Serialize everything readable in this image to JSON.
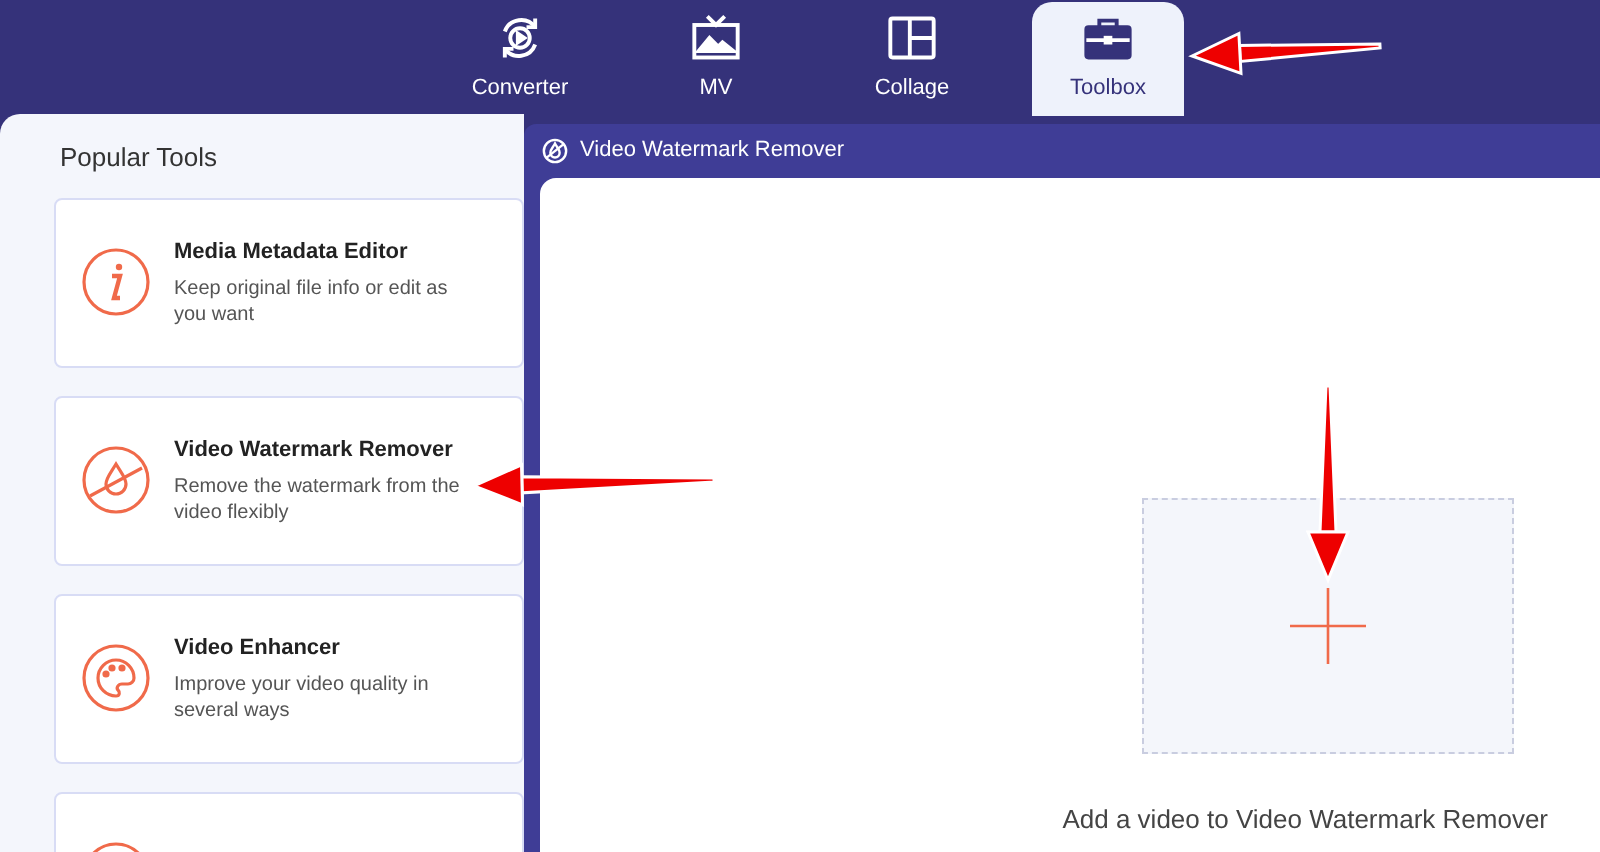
{
  "tabs": [
    {
      "label": "Converter",
      "selected": false
    },
    {
      "label": "MV",
      "selected": false
    },
    {
      "label": "Collage",
      "selected": false
    },
    {
      "label": "Toolbox",
      "selected": true
    }
  ],
  "sidebar": {
    "title": "Popular Tools",
    "tools": [
      {
        "title": "Media Metadata Editor",
        "description": "Keep original file info or edit as you want"
      },
      {
        "title": "Video Watermark Remover",
        "description": "Remove the watermark from the video flexibly"
      },
      {
        "title": "Video Enhancer",
        "description": "Improve your video quality in several ways"
      }
    ],
    "more_below": true
  },
  "panel": {
    "title": "Video Watermark Remover",
    "drop_hint": "Add a video to Video Watermark Remover"
  }
}
